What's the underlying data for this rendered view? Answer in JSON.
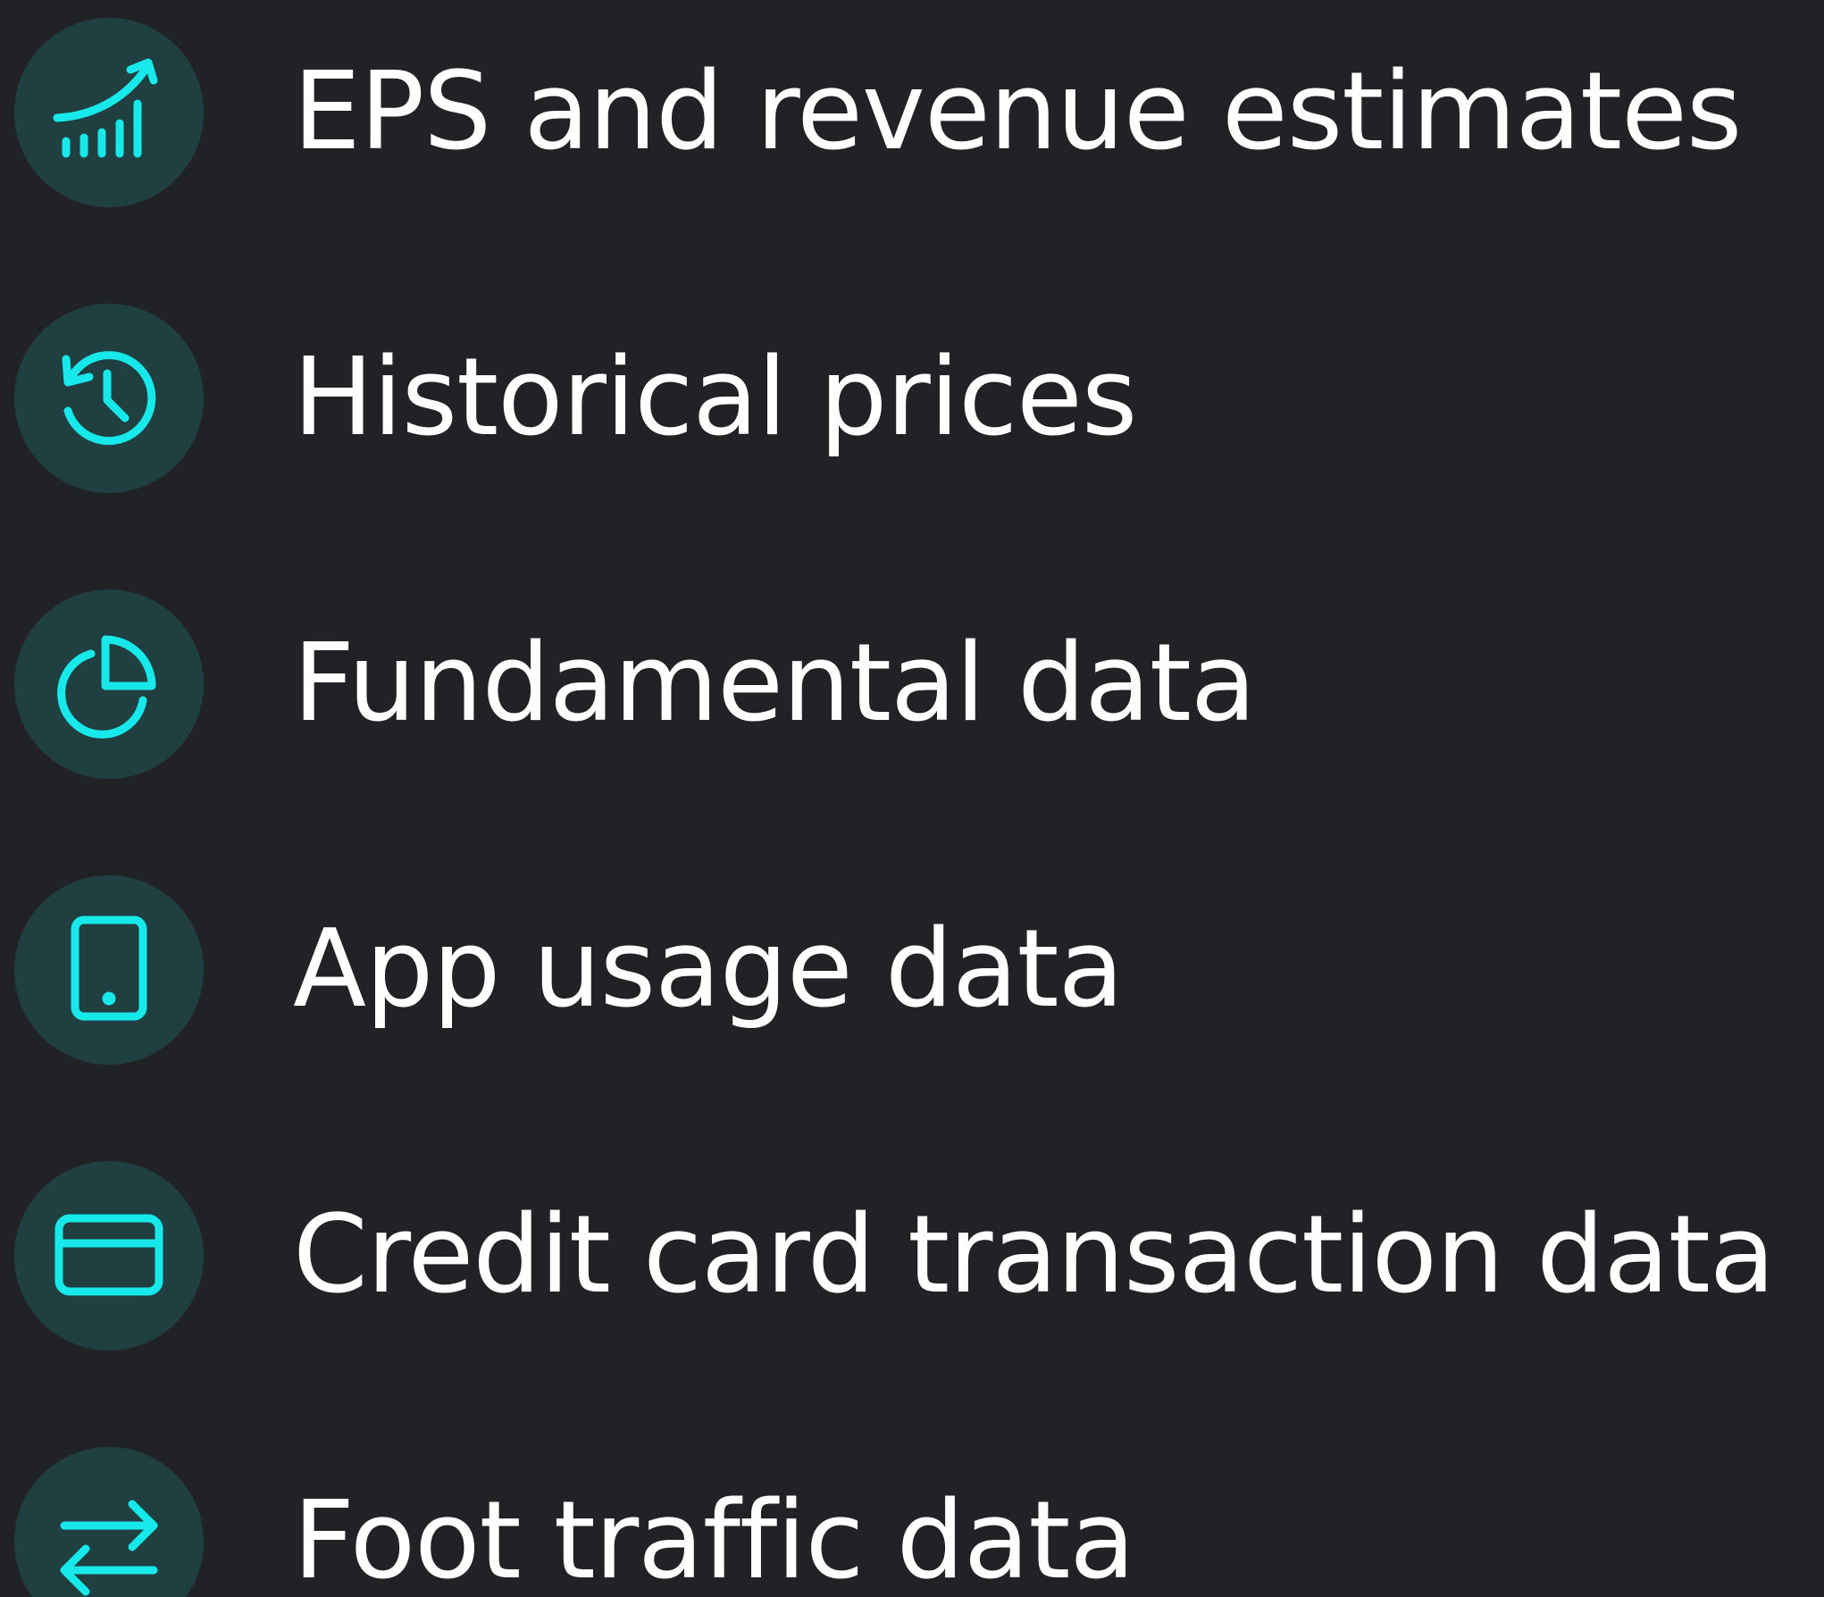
{
  "colors": {
    "background": "#212226",
    "icon_circle": "#1f3f41",
    "icon_stroke": "#17e8ea",
    "text": "#ffffff"
  },
  "items": [
    {
      "label": "EPS and revenue estimates",
      "icon": "chart-trend-icon"
    },
    {
      "label": "Historical prices",
      "icon": "history-clock-icon"
    },
    {
      "label": "Fundamental data",
      "icon": "pie-chart-icon"
    },
    {
      "label": "App usage data",
      "icon": "tablet-icon"
    },
    {
      "label": "Credit card transaction data",
      "icon": "credit-card-icon"
    },
    {
      "label": "Foot traffic data",
      "icon": "arrows-exchange-icon"
    }
  ]
}
